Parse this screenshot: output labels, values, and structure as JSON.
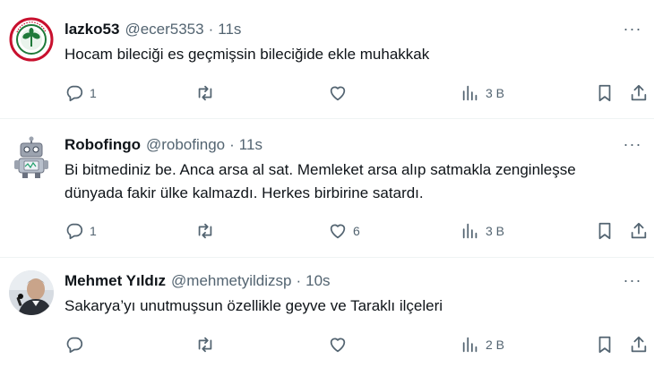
{
  "tweets": [
    {
      "name": "lazko53",
      "handle": "@ecer5353",
      "separator": "·",
      "time": "11s",
      "text": "Hocam bileciği es geçmişsin bileciğide ekle muhakkak",
      "replies": "1",
      "retweets": "",
      "likes": "",
      "views": "3 B",
      "avatar_icon": "club-crest-avatar"
    },
    {
      "name": "Robofingo",
      "handle": "@robofingo",
      "separator": "·",
      "time": "11s",
      "text": "Bi bitmediniz be. Anca arsa al sat. Memleket arsa alıp satmakla zenginleşse dünyada fakir ülke kalmazdı. Herkes birbirine satardı.",
      "replies": "1",
      "retweets": "",
      "likes": "6",
      "views": "3 B",
      "avatar_icon": "robot-avatar"
    },
    {
      "name": "Mehmet Yıldız",
      "handle": "@mehmetyildizsp",
      "separator": "·",
      "time": "10s",
      "text": "Sakarya’yı unutmuşsun özellikle geyve ve Taraklı ilçeleri",
      "replies": "",
      "retweets": "",
      "likes": "",
      "views": "2 B",
      "avatar_icon": "person-photo-avatar"
    }
  ],
  "more_glyph": "···",
  "colors": {
    "text": "#0f1419",
    "secondary": "#536471",
    "divider": "#eff3f4"
  }
}
